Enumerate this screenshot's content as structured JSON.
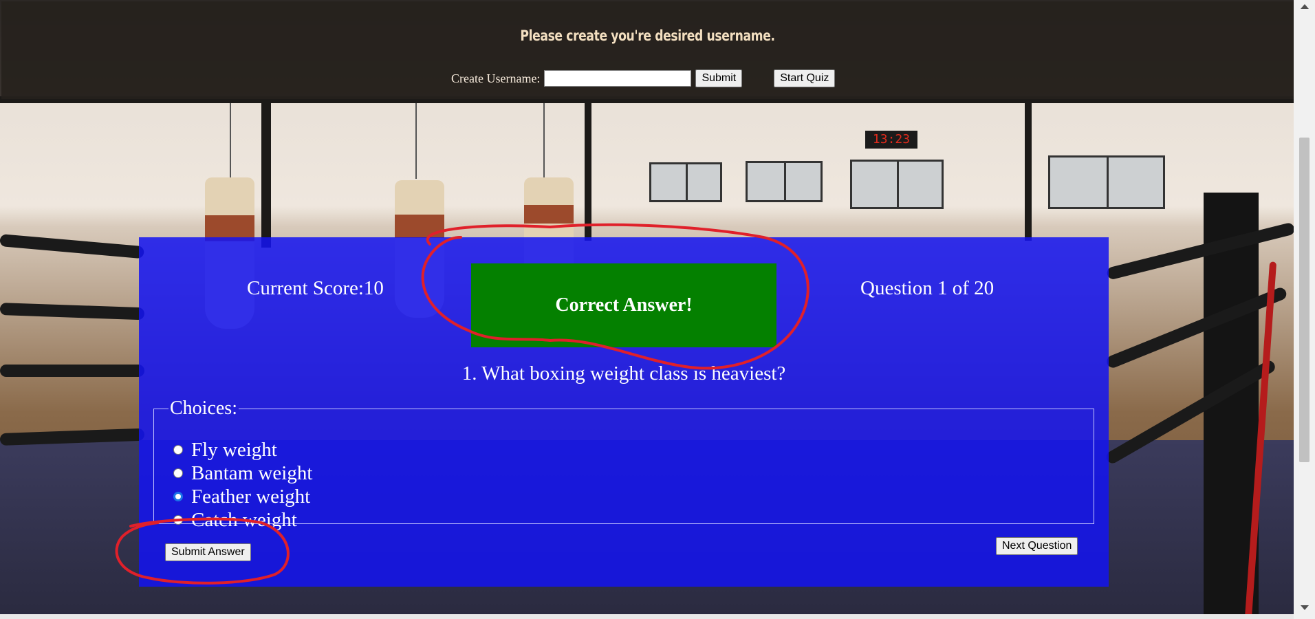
{
  "header": {
    "title": "Please create you're desired username.",
    "username_label": "Create Username:",
    "username_value": "",
    "submit_label": "Submit",
    "start_quiz_label": "Start Quiz"
  },
  "background": {
    "clock_text": "13:23"
  },
  "quiz": {
    "score_text": "Current Score:10",
    "feedback_text": "Correct Answer!",
    "feedback_color": "#048000",
    "progress_text": "Question 1 of 20",
    "question_text": "1. What boxing weight class is heaviest?",
    "choices_legend": "Choices:",
    "choices": [
      {
        "label": "Fly weight",
        "selected": false
      },
      {
        "label": "Bantam weight",
        "selected": false
      },
      {
        "label": "Feather weight",
        "selected": true
      },
      {
        "label": "Catch weight",
        "selected": false
      }
    ],
    "submit_answer_label": "Submit Answer",
    "next_question_label": "Next Question",
    "panel_color": "#1414f0"
  },
  "annotations": {
    "color": "#e0202a",
    "circled": [
      "feedback",
      "submit-answer-button"
    ]
  }
}
